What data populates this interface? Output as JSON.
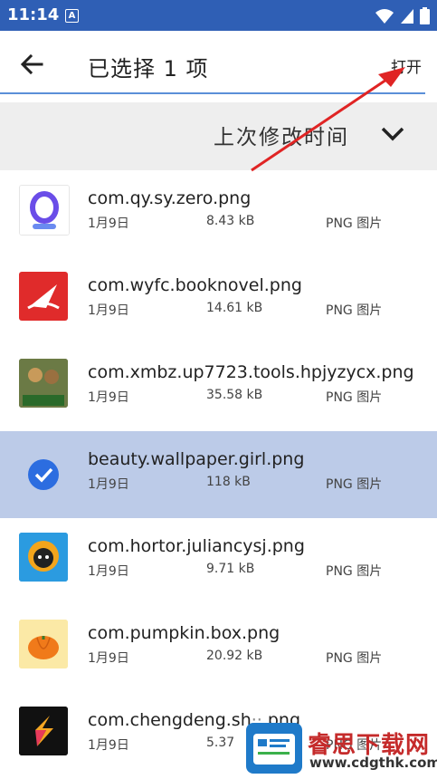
{
  "status_bar": {
    "time": "11:14",
    "a_badge": "A",
    "icons": [
      "wifi-icon",
      "signal-icon",
      "battery-icon"
    ]
  },
  "toolbar": {
    "title": "已选择 1 项",
    "open_label": "打开"
  },
  "sort": {
    "label": "上次修改时间"
  },
  "files": [
    {
      "name": "com.qy.sy.zero.png",
      "date": "1月9日",
      "size": "8.43 kB",
      "type": "PNG 图片",
      "selected": false,
      "icon": "zero-app-icon"
    },
    {
      "name": "com.wyfc.booknovel.png",
      "date": "1月9日",
      "size": "14.61 kB",
      "type": "PNG 图片",
      "selected": false,
      "icon": "booknovel-app-icon"
    },
    {
      "name": "com.xmbz.up7723.tools.hpjyzycx.png",
      "date": "1月9日",
      "size": "35.58 kB",
      "type": "PNG 图片",
      "selected": false,
      "icon": "game-query-app-icon"
    },
    {
      "name": "beauty.wallpaper.girl.png",
      "date": "1月9日",
      "size": "118 kB",
      "type": "PNG 图片",
      "selected": true,
      "icon": "check-icon"
    },
    {
      "name": "com.hortor.juliancysj.png",
      "date": "1月9日",
      "size": "9.71 kB",
      "type": "PNG 图片",
      "selected": false,
      "icon": "juliancysj-app-icon"
    },
    {
      "name": "com.pumpkin.box.png",
      "date": "1月9日",
      "size": "20.92 kB",
      "type": "PNG 图片",
      "selected": false,
      "icon": "pumpkin-app-icon"
    },
    {
      "name": "com.chengdeng.sh",
      "date": "1月9日",
      "size": "5.37",
      "type": "PNG 图片",
      "selected": false,
      "icon": "chengdeng-app-icon",
      "name_tail": ".png"
    }
  ],
  "watermark": {
    "title": "睿思下载网",
    "url": "www.cdgthk.com"
  },
  "colors": {
    "status_bar": "#2f5fb5",
    "selected_row": "#bccbe8",
    "accent": "#2c6de0",
    "arrow": "#e02424"
  }
}
